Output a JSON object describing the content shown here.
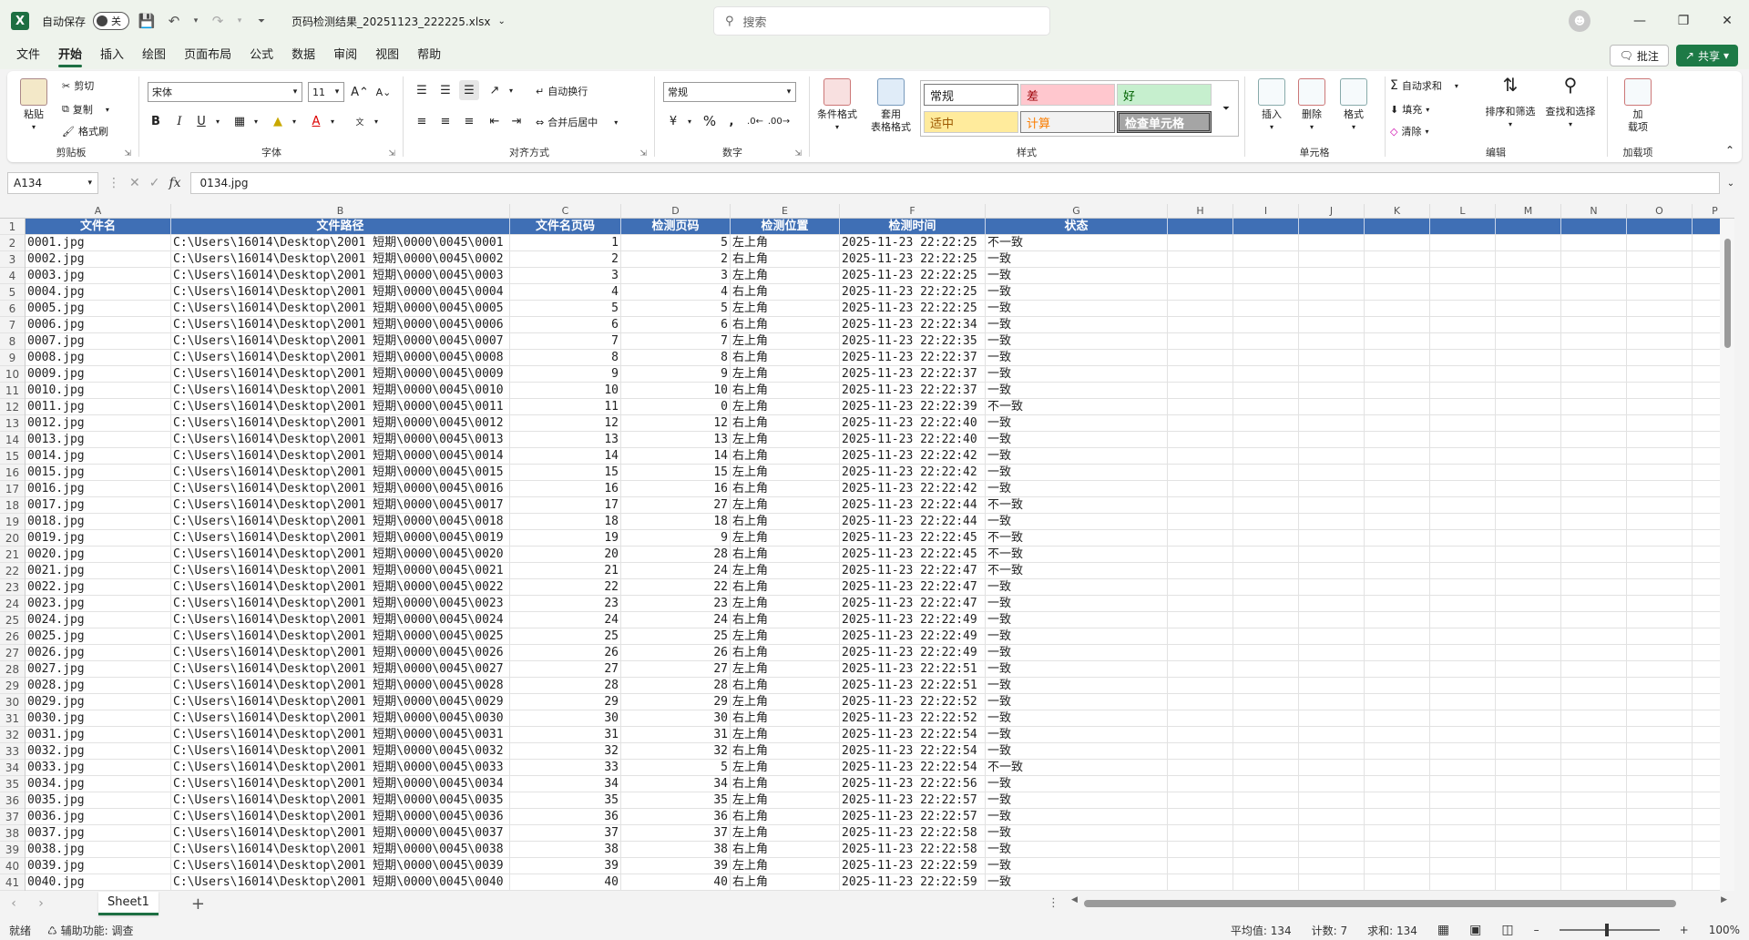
{
  "titlebar": {
    "autosave_label": "自动保存",
    "autosave_state": "关",
    "filename": "页码检测结果_20251123_222225.xlsx",
    "search_placeholder": "搜索"
  },
  "menu": {
    "tabs": [
      "文件",
      "开始",
      "插入",
      "绘图",
      "页面布局",
      "公式",
      "数据",
      "审阅",
      "视图",
      "帮助"
    ],
    "active": "开始",
    "comment_label": "批注",
    "share_label": "共享"
  },
  "ribbon": {
    "clipboard": {
      "paste": "粘贴",
      "cut": "剪切",
      "copy": "复制",
      "format_painter": "格式刷",
      "label": "剪贴板"
    },
    "font": {
      "name": "宋体",
      "size": "11",
      "label": "字体"
    },
    "alignment": {
      "wrap": "自动换行",
      "merge": "合并后居中",
      "label": "对齐方式"
    },
    "number": {
      "format": "常规",
      "label": "数字"
    },
    "styles": {
      "cond_format": "条件格式",
      "table_format_1": "套用",
      "table_format_2": "表格格式",
      "cells": [
        "常规",
        "差",
        "好",
        "适中",
        "计算",
        "检查单元格"
      ],
      "label": "样式"
    },
    "cells": {
      "insert": "插入",
      "delete": "删除",
      "format": "格式",
      "label": "单元格"
    },
    "editing": {
      "autosum": "自动求和",
      "fill": "填充",
      "clear": "清除",
      "sort_filter": "排序和筛选",
      "find_select": "查找和选择",
      "label": "编辑"
    },
    "addins": {
      "label_1": "加",
      "label_2": "载项",
      "group": "加载项"
    }
  },
  "formulabar": {
    "namebox": "A134",
    "value": "0134.jpg"
  },
  "columns": [
    "A",
    "B",
    "C",
    "D",
    "E",
    "F",
    "G",
    "H",
    "I",
    "J",
    "K",
    "L",
    "M",
    "N",
    "O",
    "P"
  ],
  "headers": [
    "文件名",
    "文件路径",
    "文件名页码",
    "检测页码",
    "检测位置",
    "检测时间",
    "状态"
  ],
  "rows": [
    [
      "0001.jpg",
      "C:\\Users\\16014\\Desktop\\2001 短期\\0000\\0045\\0001",
      "1",
      "5",
      "左上角",
      "2025-11-23 22:22:25",
      "不一致"
    ],
    [
      "0002.jpg",
      "C:\\Users\\16014\\Desktop\\2001 短期\\0000\\0045\\0002",
      "2",
      "2",
      "右上角",
      "2025-11-23 22:22:25",
      "一致"
    ],
    [
      "0003.jpg",
      "C:\\Users\\16014\\Desktop\\2001 短期\\0000\\0045\\0003",
      "3",
      "3",
      "左上角",
      "2025-11-23 22:22:25",
      "一致"
    ],
    [
      "0004.jpg",
      "C:\\Users\\16014\\Desktop\\2001 短期\\0000\\0045\\0004",
      "4",
      "4",
      "右上角",
      "2025-11-23 22:22:25",
      "一致"
    ],
    [
      "0005.jpg",
      "C:\\Users\\16014\\Desktop\\2001 短期\\0000\\0045\\0005",
      "5",
      "5",
      "左上角",
      "2025-11-23 22:22:25",
      "一致"
    ],
    [
      "0006.jpg",
      "C:\\Users\\16014\\Desktop\\2001 短期\\0000\\0045\\0006",
      "6",
      "6",
      "右上角",
      "2025-11-23 22:22:34",
      "一致"
    ],
    [
      "0007.jpg",
      "C:\\Users\\16014\\Desktop\\2001 短期\\0000\\0045\\0007",
      "7",
      "7",
      "左上角",
      "2025-11-23 22:22:35",
      "一致"
    ],
    [
      "0008.jpg",
      "C:\\Users\\16014\\Desktop\\2001 短期\\0000\\0045\\0008",
      "8",
      "8",
      "右上角",
      "2025-11-23 22:22:37",
      "一致"
    ],
    [
      "0009.jpg",
      "C:\\Users\\16014\\Desktop\\2001 短期\\0000\\0045\\0009",
      "9",
      "9",
      "左上角",
      "2025-11-23 22:22:37",
      "一致"
    ],
    [
      "0010.jpg",
      "C:\\Users\\16014\\Desktop\\2001 短期\\0000\\0045\\0010",
      "10",
      "10",
      "右上角",
      "2025-11-23 22:22:37",
      "一致"
    ],
    [
      "0011.jpg",
      "C:\\Users\\16014\\Desktop\\2001 短期\\0000\\0045\\0011",
      "11",
      "0",
      "左上角",
      "2025-11-23 22:22:39",
      "不一致"
    ],
    [
      "0012.jpg",
      "C:\\Users\\16014\\Desktop\\2001 短期\\0000\\0045\\0012",
      "12",
      "12",
      "右上角",
      "2025-11-23 22:22:40",
      "一致"
    ],
    [
      "0013.jpg",
      "C:\\Users\\16014\\Desktop\\2001 短期\\0000\\0045\\0013",
      "13",
      "13",
      "左上角",
      "2025-11-23 22:22:40",
      "一致"
    ],
    [
      "0014.jpg",
      "C:\\Users\\16014\\Desktop\\2001 短期\\0000\\0045\\0014",
      "14",
      "14",
      "右上角",
      "2025-11-23 22:22:42",
      "一致"
    ],
    [
      "0015.jpg",
      "C:\\Users\\16014\\Desktop\\2001 短期\\0000\\0045\\0015",
      "15",
      "15",
      "左上角",
      "2025-11-23 22:22:42",
      "一致"
    ],
    [
      "0016.jpg",
      "C:\\Users\\16014\\Desktop\\2001 短期\\0000\\0045\\0016",
      "16",
      "16",
      "右上角",
      "2025-11-23 22:22:42",
      "一致"
    ],
    [
      "0017.jpg",
      "C:\\Users\\16014\\Desktop\\2001 短期\\0000\\0045\\0017",
      "17",
      "27",
      "左上角",
      "2025-11-23 22:22:44",
      "不一致"
    ],
    [
      "0018.jpg",
      "C:\\Users\\16014\\Desktop\\2001 短期\\0000\\0045\\0018",
      "18",
      "18",
      "右上角",
      "2025-11-23 22:22:44",
      "一致"
    ],
    [
      "0019.jpg",
      "C:\\Users\\16014\\Desktop\\2001 短期\\0000\\0045\\0019",
      "19",
      "9",
      "左上角",
      "2025-11-23 22:22:45",
      "不一致"
    ],
    [
      "0020.jpg",
      "C:\\Users\\16014\\Desktop\\2001 短期\\0000\\0045\\0020",
      "20",
      "28",
      "右上角",
      "2025-11-23 22:22:45",
      "不一致"
    ],
    [
      "0021.jpg",
      "C:\\Users\\16014\\Desktop\\2001 短期\\0000\\0045\\0021",
      "21",
      "24",
      "左上角",
      "2025-11-23 22:22:47",
      "不一致"
    ],
    [
      "0022.jpg",
      "C:\\Users\\16014\\Desktop\\2001 短期\\0000\\0045\\0022",
      "22",
      "22",
      "右上角",
      "2025-11-23 22:22:47",
      "一致"
    ],
    [
      "0023.jpg",
      "C:\\Users\\16014\\Desktop\\2001 短期\\0000\\0045\\0023",
      "23",
      "23",
      "左上角",
      "2025-11-23 22:22:47",
      "一致"
    ],
    [
      "0024.jpg",
      "C:\\Users\\16014\\Desktop\\2001 短期\\0000\\0045\\0024",
      "24",
      "24",
      "右上角",
      "2025-11-23 22:22:49",
      "一致"
    ],
    [
      "0025.jpg",
      "C:\\Users\\16014\\Desktop\\2001 短期\\0000\\0045\\0025",
      "25",
      "25",
      "左上角",
      "2025-11-23 22:22:49",
      "一致"
    ],
    [
      "0026.jpg",
      "C:\\Users\\16014\\Desktop\\2001 短期\\0000\\0045\\0026",
      "26",
      "26",
      "右上角",
      "2025-11-23 22:22:49",
      "一致"
    ],
    [
      "0027.jpg",
      "C:\\Users\\16014\\Desktop\\2001 短期\\0000\\0045\\0027",
      "27",
      "27",
      "左上角",
      "2025-11-23 22:22:51",
      "一致"
    ],
    [
      "0028.jpg",
      "C:\\Users\\16014\\Desktop\\2001 短期\\0000\\0045\\0028",
      "28",
      "28",
      "右上角",
      "2025-11-23 22:22:51",
      "一致"
    ],
    [
      "0029.jpg",
      "C:\\Users\\16014\\Desktop\\2001 短期\\0000\\0045\\0029",
      "29",
      "29",
      "左上角",
      "2025-11-23 22:22:52",
      "一致"
    ],
    [
      "0030.jpg",
      "C:\\Users\\16014\\Desktop\\2001 短期\\0000\\0045\\0030",
      "30",
      "30",
      "右上角",
      "2025-11-23 22:22:52",
      "一致"
    ],
    [
      "0031.jpg",
      "C:\\Users\\16014\\Desktop\\2001 短期\\0000\\0045\\0031",
      "31",
      "31",
      "左上角",
      "2025-11-23 22:22:54",
      "一致"
    ],
    [
      "0032.jpg",
      "C:\\Users\\16014\\Desktop\\2001 短期\\0000\\0045\\0032",
      "32",
      "32",
      "右上角",
      "2025-11-23 22:22:54",
      "一致"
    ],
    [
      "0033.jpg",
      "C:\\Users\\16014\\Desktop\\2001 短期\\0000\\0045\\0033",
      "33",
      "5",
      "左上角",
      "2025-11-23 22:22:54",
      "不一致"
    ],
    [
      "0034.jpg",
      "C:\\Users\\16014\\Desktop\\2001 短期\\0000\\0045\\0034",
      "34",
      "34",
      "右上角",
      "2025-11-23 22:22:56",
      "一致"
    ],
    [
      "0035.jpg",
      "C:\\Users\\16014\\Desktop\\2001 短期\\0000\\0045\\0035",
      "35",
      "35",
      "左上角",
      "2025-11-23 22:22:57",
      "一致"
    ],
    [
      "0036.jpg",
      "C:\\Users\\16014\\Desktop\\2001 短期\\0000\\0045\\0036",
      "36",
      "36",
      "右上角",
      "2025-11-23 22:22:57",
      "一致"
    ],
    [
      "0037.jpg",
      "C:\\Users\\16014\\Desktop\\2001 短期\\0000\\0045\\0037",
      "37",
      "37",
      "左上角",
      "2025-11-23 22:22:58",
      "一致"
    ],
    [
      "0038.jpg",
      "C:\\Users\\16014\\Desktop\\2001 短期\\0000\\0045\\0038",
      "38",
      "38",
      "右上角",
      "2025-11-23 22:22:58",
      "一致"
    ],
    [
      "0039.jpg",
      "C:\\Users\\16014\\Desktop\\2001 短期\\0000\\0045\\0039",
      "39",
      "39",
      "左上角",
      "2025-11-23 22:22:59",
      "一致"
    ],
    [
      "0040.jpg",
      "C:\\Users\\16014\\Desktop\\2001 短期\\0000\\0045\\0040",
      "40",
      "40",
      "右上角",
      "2025-11-23 22:22:59",
      "一致"
    ]
  ],
  "sheets": {
    "active": "Sheet1"
  },
  "status": {
    "ready": "就绪",
    "accessibility": "辅助功能: 调查",
    "average": "平均值: 134",
    "count": "计数: 7",
    "sum": "求和: 134",
    "zoom": "100%"
  },
  "colors": {
    "header_fill": "#3f6fb5",
    "accent": "#1d6f42",
    "bad_fill": "#ffc7ce",
    "good_fill": "#c6efce",
    "neutral_fill": "#ffeb9c"
  }
}
